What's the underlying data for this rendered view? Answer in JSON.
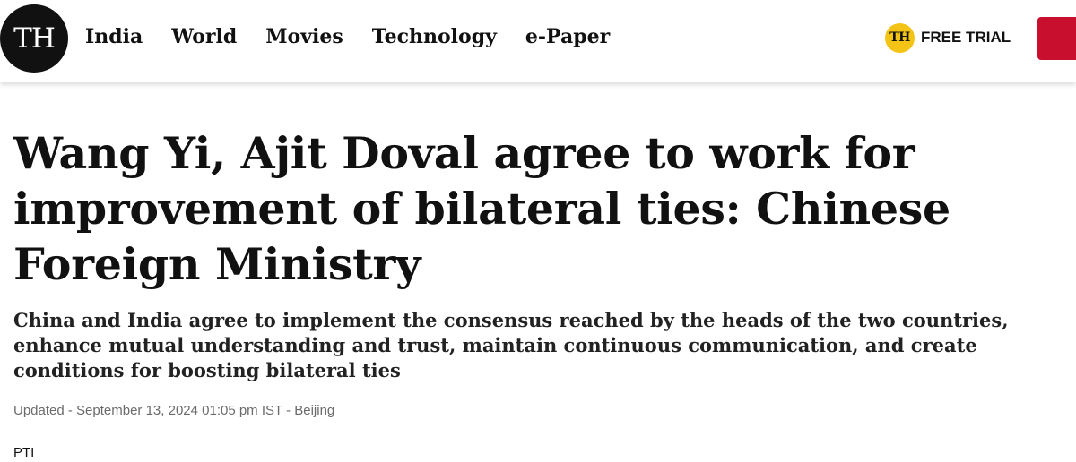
{
  "header": {
    "logo_text": "TH",
    "nav": [
      "India",
      "World",
      "Movies",
      "Technology",
      "e-Paper"
    ],
    "trial_badge": "TH",
    "trial_label": "FREE TRIAL",
    "accent_color": "#c8102e",
    "badge_color": "#f3c316"
  },
  "article": {
    "headline": "Wang Yi, Ajit Doval agree to work for improvement of bilateral ties: Chinese Foreign Ministry",
    "standfirst": "China and India agree to implement the consensus reached by the heads of the two countries, enhance mutual understanding and trust, maintain continuous communication, and create conditions for boosting bilateral ties",
    "meta": "Updated - September 13, 2024 01:05 pm IST - Beijing",
    "byline": "PTI"
  }
}
